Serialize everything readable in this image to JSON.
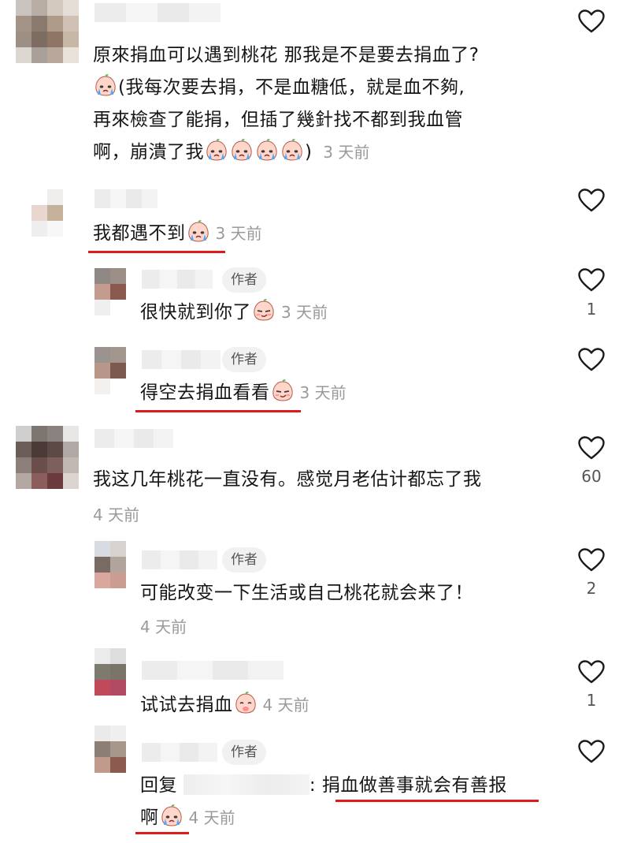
{
  "comments": [
    {
      "id": "c1",
      "text": "原來捐血可以遇到桃花 那我是不是要去捐血了?",
      "line2": "(我每次要去捐，不是血糖低，就是血不夠,",
      "line3": "再來檢查了能捐，但插了幾針找不都到我血管",
      "line4": "啊，崩潰了我",
      "time": "3 天前"
    },
    {
      "id": "r1",
      "text": "我都遇不到",
      "time": "3 天前"
    },
    {
      "id": "r2",
      "badge": "作者",
      "text": "很快就到你了",
      "time": "3 天前",
      "likes": "1"
    },
    {
      "id": "r3",
      "badge": "作者",
      "text": "得空去捐血看看",
      "time": "3 天前"
    },
    {
      "id": "c2",
      "text": "我这几年桃花一直没有。感觉月老估计都忘了我",
      "time": "4 天前",
      "likes": "60"
    },
    {
      "id": "r4",
      "badge": "作者",
      "text": "可能改变一下生活或自己桃花就会来了！",
      "time": "4 天前",
      "likes": "2"
    },
    {
      "id": "r5",
      "text": "试试去捐血",
      "time": "4 天前",
      "likes": "1"
    },
    {
      "id": "r6",
      "badge": "作者",
      "reply_prefix": "回复",
      "colon": ":",
      "text": "捐血做善事就会有善报",
      "line2": "啊",
      "time": "4 天前"
    }
  ],
  "icons": {
    "like": "heart-outline-icon",
    "emoji_cry": "crying-peach-emoji",
    "emoji_smug": "smug-peach-emoji",
    "emoji_blush": "shy-peach-emoji"
  },
  "colors": {
    "underline": "#e01a1a",
    "time": "#9a9a9a"
  }
}
